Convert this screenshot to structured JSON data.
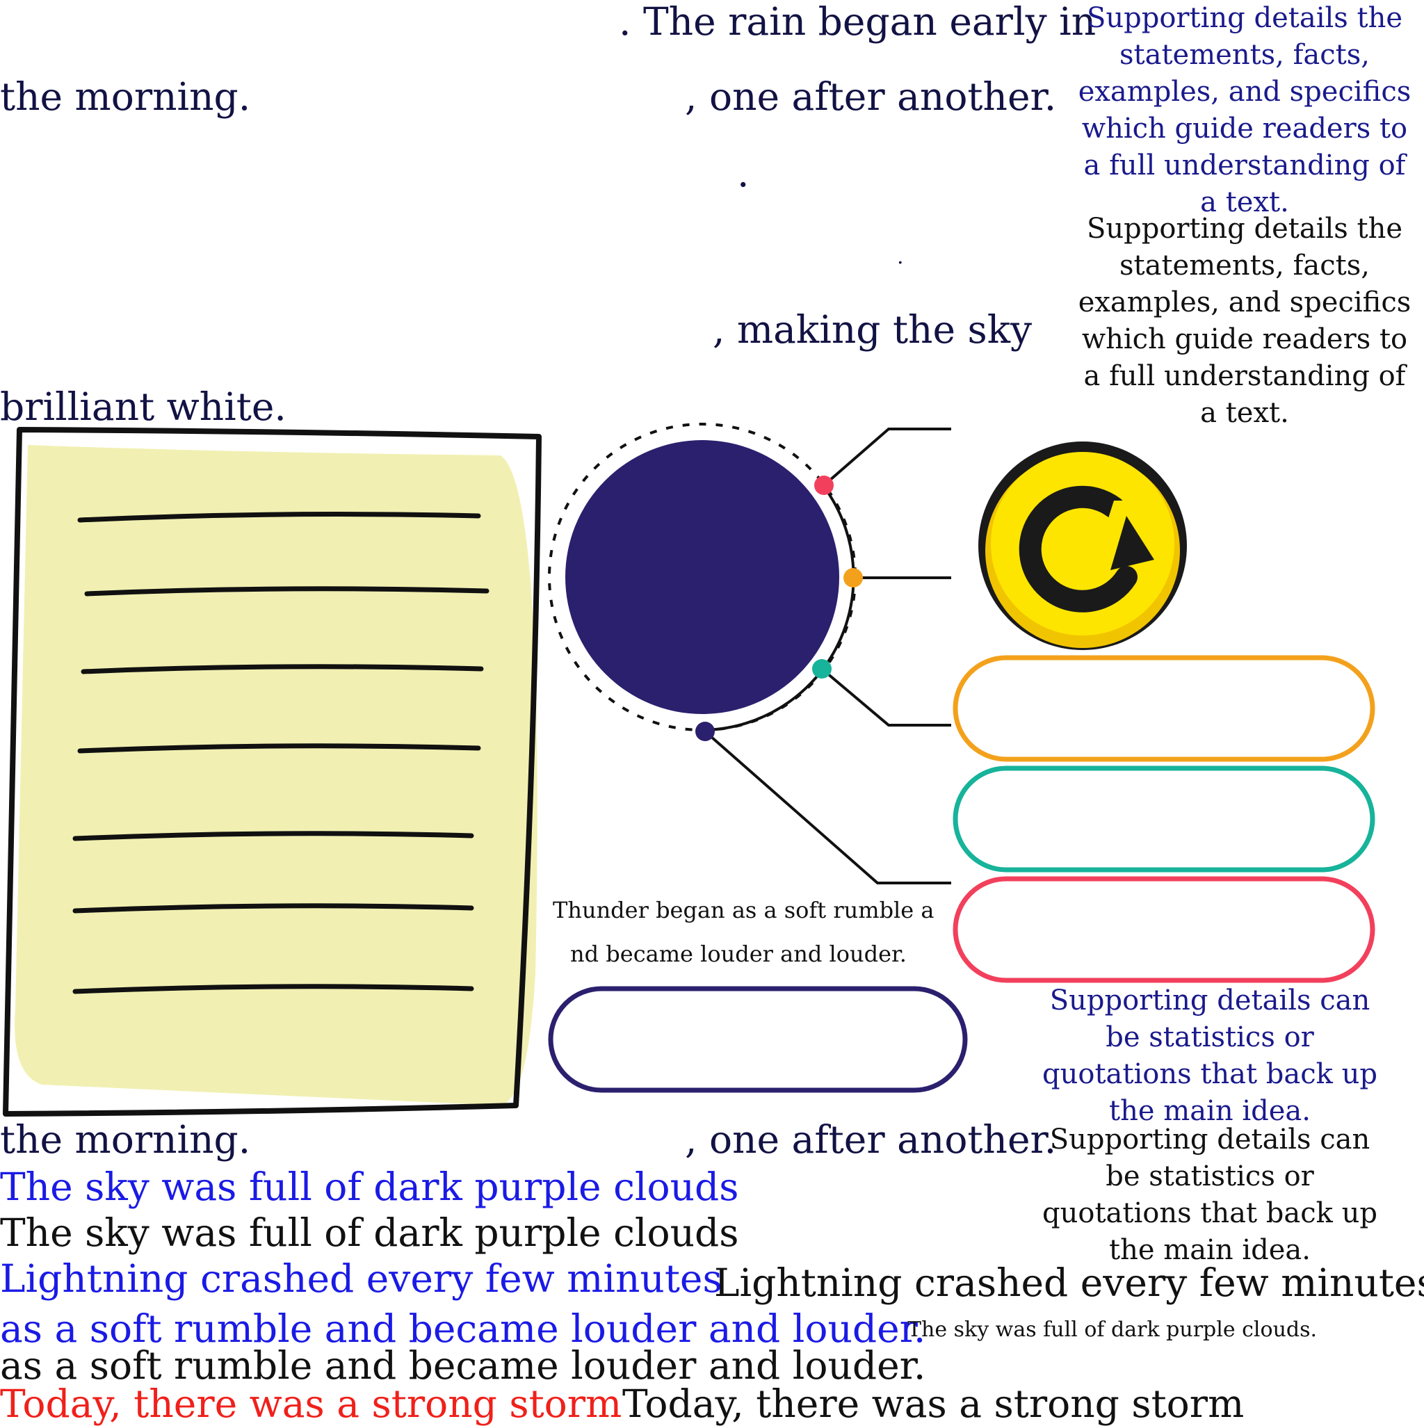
{
  "top_story": {
    "line1": ". The rain began early in",
    "line2a": "the morning.",
    "line2b": ", one after another.",
    "dot1": ".",
    "dot2": ".",
    "line3": ", making the sky",
    "line4": "brilliant white."
  },
  "info_boxes": {
    "main1": "Supporting details the statements, facts, examples, and specifics which guide readers to a full understanding of a text.",
    "main2": "Supporting details the statements, facts, examples, and specifics which guide readers to a full understanding of a text.",
    "stats1": "Supporting details can be statistics or quotations that back up the main idea.",
    "stats2": "Supporting details can be statistics or quotations that back up the main idea."
  },
  "thunder_caption": {
    "line1": "Thunder began as a soft rumble a",
    "line2": "nd became louder and louder."
  },
  "bottom_story": {
    "line_morning": "the morning.",
    "line_after": ", one after another.",
    "sky_blue": "The sky was full of dark purple clouds",
    "sky_black": "The sky was full of dark purple clouds",
    "lightning_blue": "Lightning crashed every few minutes",
    "lightning_black": "Lightning crashed every few minutes",
    "rumble_blue": "as a soft rumble and became louder and louder.",
    "rumble_black": "as a soft rumble and became louder and louder.",
    "sky_small": "The sky was full of dark purple clouds.",
    "storm_red": "Today, there was a strong storm",
    "storm_black": "Today, there was a strong storm"
  },
  "icons": {
    "refresh": "refresh-icon"
  },
  "colors": {
    "navy": "#2b206e",
    "paper": "#f1f0b2",
    "orange": "#f3a11c",
    "teal": "#17b39a",
    "pink": "#f2405c",
    "yellow": "#fde500"
  }
}
